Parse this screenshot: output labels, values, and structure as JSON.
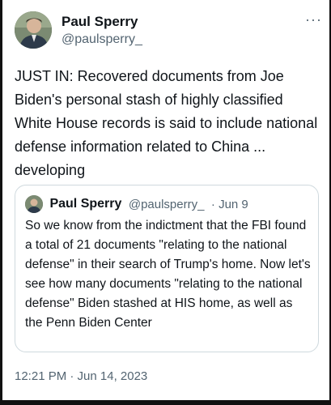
{
  "author": {
    "display_name": "Paul Sperry",
    "handle": "@paulsperry_"
  },
  "tweet": {
    "text": "JUST IN: Recovered documents from Joe Biden's personal stash of highly classified White House records is said to include national defense information related to China ... developing",
    "timestamp": "12:21 PM · Jun 14, 2023"
  },
  "quoted_tweet": {
    "display_name": "Paul Sperry",
    "handle": "@paulsperry_",
    "date": "· Jun 9",
    "text": "So we know from the indictment that the FBI found a total of 21 documents \"relating to the national defense\" in their search of Trump's home. Now let's see how many documents \"relating to the national defense\" Biden stashed at HIS home, as well as the Penn Biden Center"
  },
  "icons": {
    "more": "more-options-icon"
  }
}
